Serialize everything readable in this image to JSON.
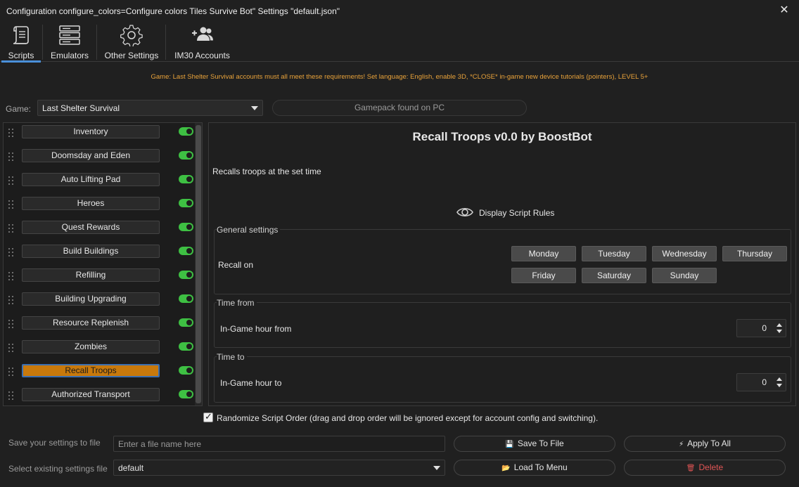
{
  "window": {
    "title": "Configuration configure_colors=Configure colors Tiles Survive Bot\" Settings \"default.json\"",
    "close_glyph": "✕"
  },
  "tabs": [
    {
      "label": "Scripts",
      "icon": "scroll-icon",
      "active": true
    },
    {
      "label": "Emulators",
      "icon": "server-icon"
    },
    {
      "label": "Other Settings",
      "icon": "gear-icon"
    },
    {
      "label": "IM30 Accounts",
      "icon": "users-add-icon"
    }
  ],
  "warning": "Game: Last Shelter Survival accounts must all meet these requirements! Set language: English, enable 3D, *CLOSE* in-game new device tutorials (pointers), LEVEL 5+",
  "game": {
    "label": "Game:",
    "selected": "Last Shelter Survival",
    "gamepack_status": "Gamepack found on PC"
  },
  "scripts": [
    {
      "label": "Inventory",
      "enabled": true
    },
    {
      "label": "Doomsday and Eden",
      "enabled": true
    },
    {
      "label": "Auto Lifting Pad",
      "enabled": true
    },
    {
      "label": "Heroes",
      "enabled": true
    },
    {
      "label": "Quest Rewards",
      "enabled": true
    },
    {
      "label": "Build Buildings",
      "enabled": true
    },
    {
      "label": "Refilling",
      "enabled": true
    },
    {
      "label": "Building Upgrading",
      "enabled": true
    },
    {
      "label": "Resource Replenish",
      "enabled": true
    },
    {
      "label": "Zombies",
      "enabled": true
    },
    {
      "label": "Recall Troops",
      "enabled": true,
      "active": true
    },
    {
      "label": "Authorized Transport",
      "enabled": true
    }
  ],
  "detail": {
    "title": "Recall Troops v0.0 by BoostBot",
    "description": "Recalls troops at the set time",
    "rules_link": "Display Script Rules",
    "general": {
      "title": "General settings",
      "recall_label": "Recall on",
      "days": [
        "Monday",
        "Tuesday",
        "Wednesday",
        "Thursday",
        "Friday",
        "Saturday",
        "Sunday"
      ]
    },
    "time_from": {
      "title": "Time from",
      "label": "In-Game hour from",
      "value": "0"
    },
    "time_to": {
      "title": "Time to",
      "label": "In-Game hour to",
      "value": "0"
    }
  },
  "randomize": {
    "checked": true,
    "check_glyph": "✓",
    "label": "Randomize Script Order (drag and drop order will be ignored except for account config and switching)."
  },
  "bottom": {
    "save_label": "Save your settings to file",
    "filename_placeholder": "Enter a file name here",
    "select_label": "Select existing settings file",
    "selected_file": "default",
    "save_button": "Save To File",
    "apply_button": "Apply To All",
    "load_button": "Load To Menu",
    "delete_button": "Delete",
    "save_glyph": "💾",
    "apply_glyph": "⚡",
    "load_glyph": "📂",
    "delete_glyph": "🗑"
  },
  "colors": {
    "accent": "#4a90d9",
    "warning": "#e8a23a",
    "active_script": "#c8790c",
    "toggle_on": "#3ec043",
    "delete": "#e05555",
    "save_icon": "#e0a030"
  }
}
